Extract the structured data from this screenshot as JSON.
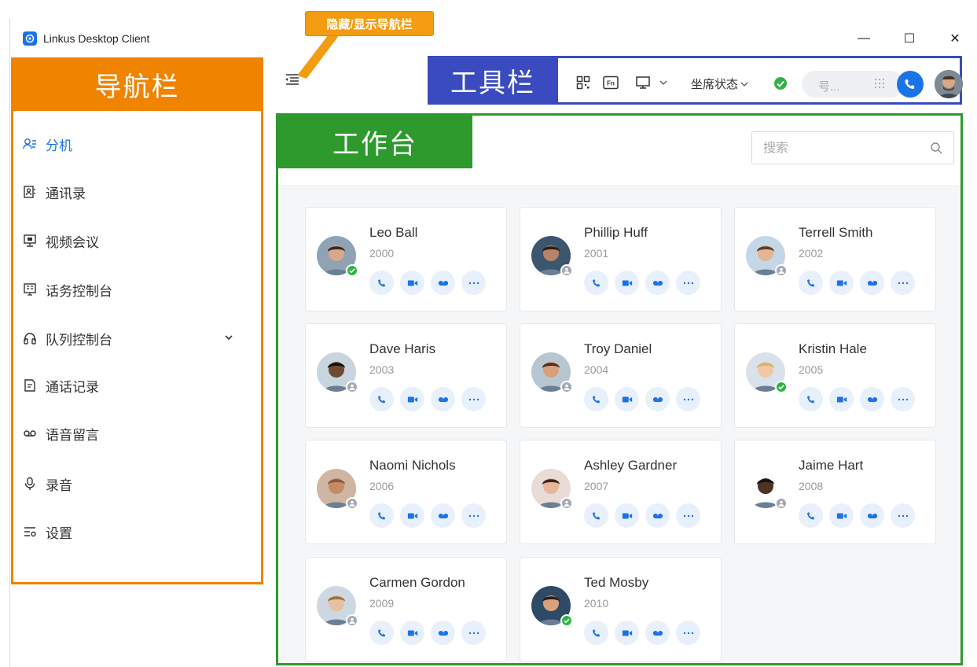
{
  "window": {
    "title": "Linkus Desktop Client",
    "controls": {
      "minimize": "—",
      "maximize": "☐",
      "close": "✕"
    }
  },
  "annotations": {
    "callout": "隐藏/显示导航栏",
    "nav_label": "导航栏",
    "toolbar_label": "工具栏",
    "workspace_label": "工作台"
  },
  "sidebar": {
    "items": [
      {
        "label": "分机",
        "icon": "extension-icon",
        "active": true
      },
      {
        "label": "通讯录",
        "icon": "contacts-icon",
        "active": false
      },
      {
        "label": "视频会议",
        "icon": "video-conference-icon",
        "active": false
      },
      {
        "label": "话务控制台",
        "icon": "operator-console-icon",
        "active": false
      },
      {
        "label": "队列控制台",
        "icon": "headset-icon",
        "active": false,
        "expandable": true
      },
      {
        "label": "通话记录",
        "icon": "call-log-icon",
        "active": false
      },
      {
        "label": "语音留言",
        "icon": "voicemail-icon",
        "active": false
      },
      {
        "label": "录音",
        "icon": "microphone-icon",
        "active": false
      },
      {
        "label": "设置",
        "icon": "settings-icon",
        "active": false
      }
    ]
  },
  "toolbar": {
    "agent_status_label": "坐席状态",
    "dial_placeholder": "号..."
  },
  "workspace": {
    "search_placeholder": "搜索",
    "contacts": [
      {
        "name": "Leo Ball",
        "ext": "2000",
        "status": "online"
      },
      {
        "name": "Phillip Huff",
        "ext": "2001",
        "status": "offline"
      },
      {
        "name": "Terrell Smith",
        "ext": "2002",
        "status": "offline"
      },
      {
        "name": "Dave Haris",
        "ext": "2003",
        "status": "offline"
      },
      {
        "name": "Troy Daniel",
        "ext": "2004",
        "status": "offline"
      },
      {
        "name": "Kristin Hale",
        "ext": "2005",
        "status": "online"
      },
      {
        "name": "Naomi Nichols",
        "ext": "2006",
        "status": "offline"
      },
      {
        "name": "Ashley Gardner",
        "ext": "2007",
        "status": "offline"
      },
      {
        "name": "Jaime Hart",
        "ext": "2008",
        "status": "offline"
      },
      {
        "name": "Carmen Gordon",
        "ext": "2009",
        "status": "offline"
      },
      {
        "name": "Ted Mosby",
        "ext": "2010",
        "status": "online"
      }
    ]
  },
  "colors": {
    "accent": "#1a73e8",
    "nav_annotation": "#f08300",
    "toolbar_annotation": "#3a4bbf",
    "workspace_annotation": "#2e9a2e",
    "online": "#2fb344",
    "offline": "#a4a8b4"
  }
}
